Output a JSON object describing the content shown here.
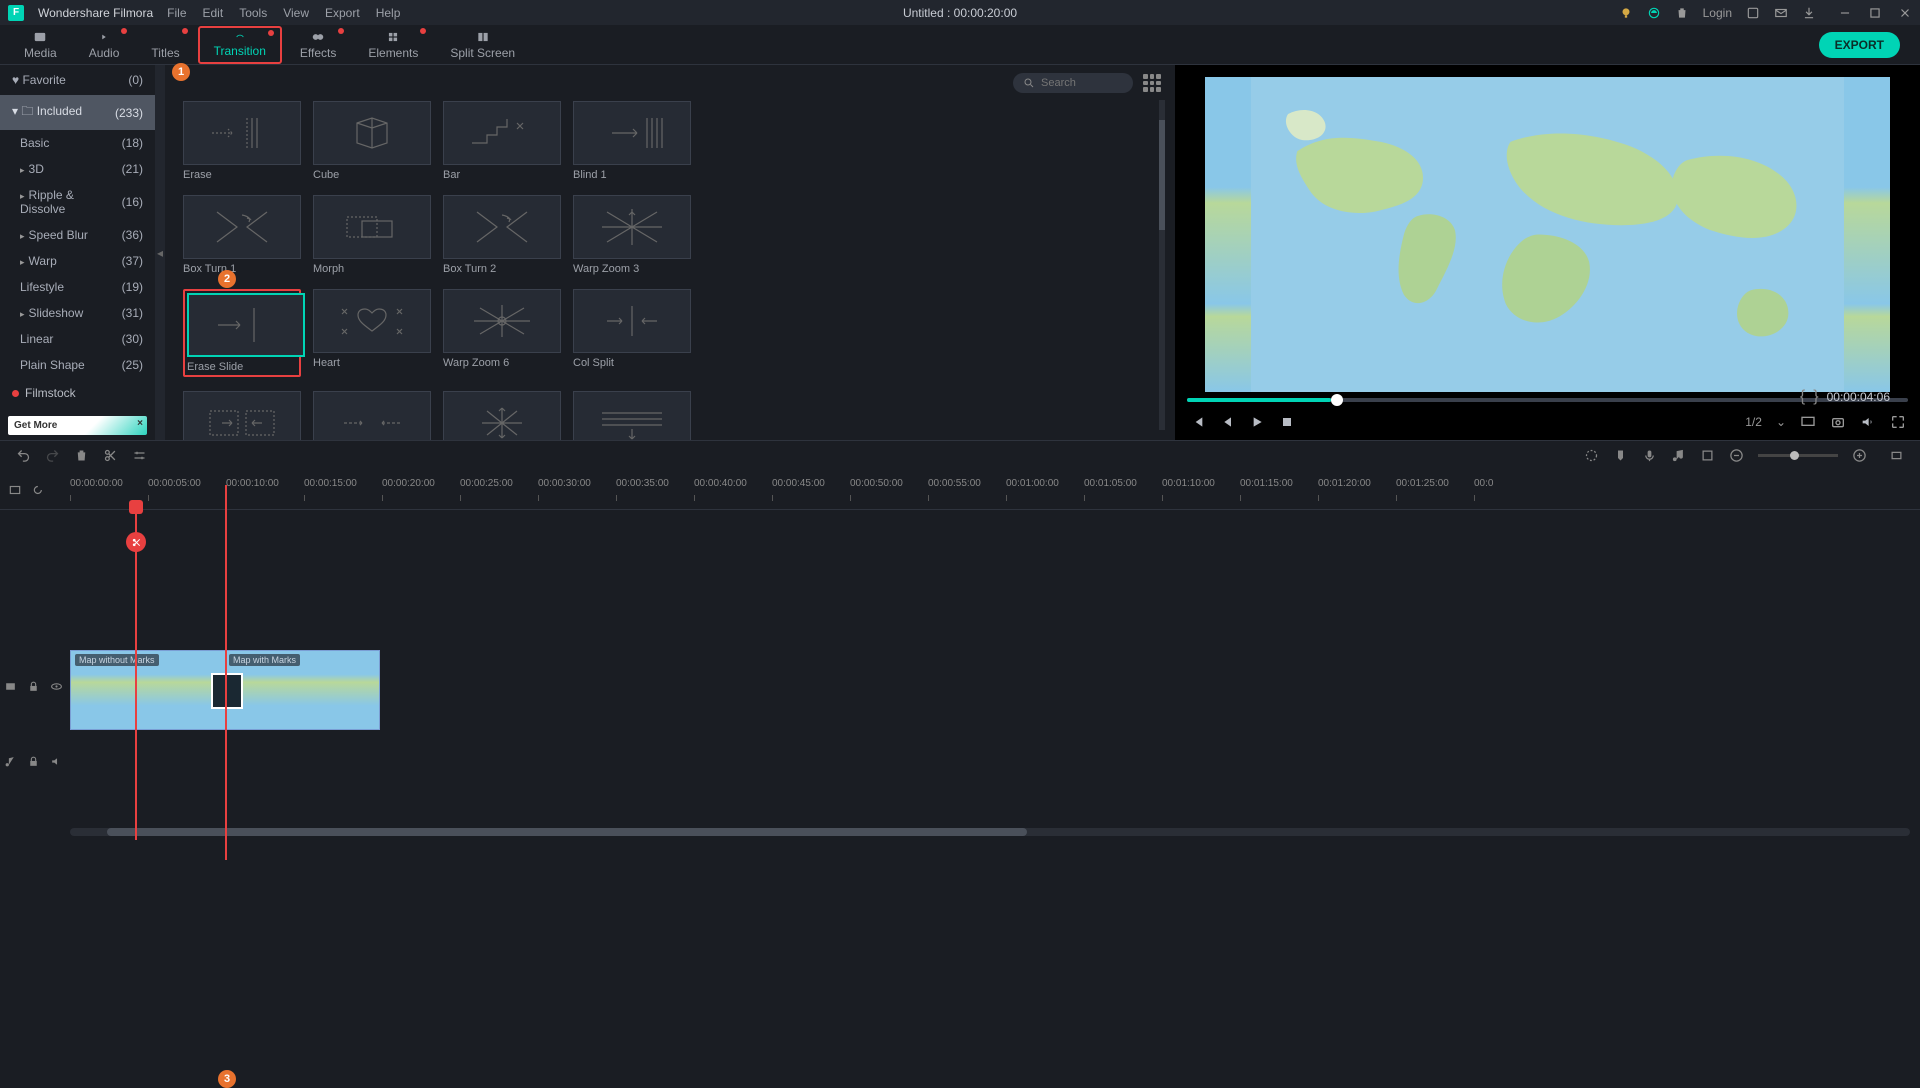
{
  "app": {
    "name": "Wondershare Filmora",
    "title": "Untitled : 00:00:20:00",
    "login": "Login"
  },
  "menu": [
    "File",
    "Edit",
    "Tools",
    "View",
    "Export",
    "Help"
  ],
  "tabs": [
    {
      "label": "Media"
    },
    {
      "label": "Audio"
    },
    {
      "label": "Titles"
    },
    {
      "label": "Transition"
    },
    {
      "label": "Effects"
    },
    {
      "label": "Elements"
    },
    {
      "label": "Split Screen"
    }
  ],
  "export": "EXPORT",
  "sidebar": {
    "favorite": {
      "label": "Favorite",
      "count": "(0)"
    },
    "included": {
      "label": "Included",
      "count": "(233)"
    },
    "items": [
      {
        "label": "Basic",
        "count": "(18)"
      },
      {
        "label": "3D",
        "count": "(21)",
        "arrow": true
      },
      {
        "label": "Ripple & Dissolve",
        "count": "(16)",
        "arrow": true
      },
      {
        "label": "Speed Blur",
        "count": "(36)",
        "arrow": true
      },
      {
        "label": "Warp",
        "count": "(37)",
        "arrow": true
      },
      {
        "label": "Lifestyle",
        "count": "(19)"
      },
      {
        "label": "Slideshow",
        "count": "(31)",
        "arrow": true
      },
      {
        "label": "Linear",
        "count": "(30)"
      },
      {
        "label": "Plain Shape",
        "count": "(25)"
      }
    ],
    "filmstock": "Filmstock",
    "promo": "Get More"
  },
  "search": {
    "placeholder": "Search"
  },
  "transitions": [
    {
      "label": "Erase"
    },
    {
      "label": "Cube"
    },
    {
      "label": "Bar"
    },
    {
      "label": "Blind 1"
    },
    {
      "label": "Box Turn 1"
    },
    {
      "label": "Morph"
    },
    {
      "label": "Box Turn 2"
    },
    {
      "label": "Warp Zoom 3"
    },
    {
      "label": "Erase Slide"
    },
    {
      "label": "Heart"
    },
    {
      "label": "Warp Zoom 6"
    },
    {
      "label": "Col Split"
    }
  ],
  "preview": {
    "timecode": "00:00:04:06",
    "zoom": "1/2"
  },
  "ruler": [
    "00:00:00:00",
    "00:00:05:00",
    "00:00:10:00",
    "00:00:15:00",
    "00:00:20:00",
    "00:00:25:00",
    "00:00:30:00",
    "00:00:35:00",
    "00:00:40:00",
    "00:00:45:00",
    "00:00:50:00",
    "00:00:55:00",
    "00:01:00:00",
    "00:01:05:00",
    "00:01:10:00",
    "00:01:15:00",
    "00:01:20:00",
    "00:01:25:00",
    "00:0"
  ],
  "clips": [
    "Map without Marks",
    "Map with Marks"
  ],
  "callouts": [
    "1",
    "2",
    "3"
  ]
}
